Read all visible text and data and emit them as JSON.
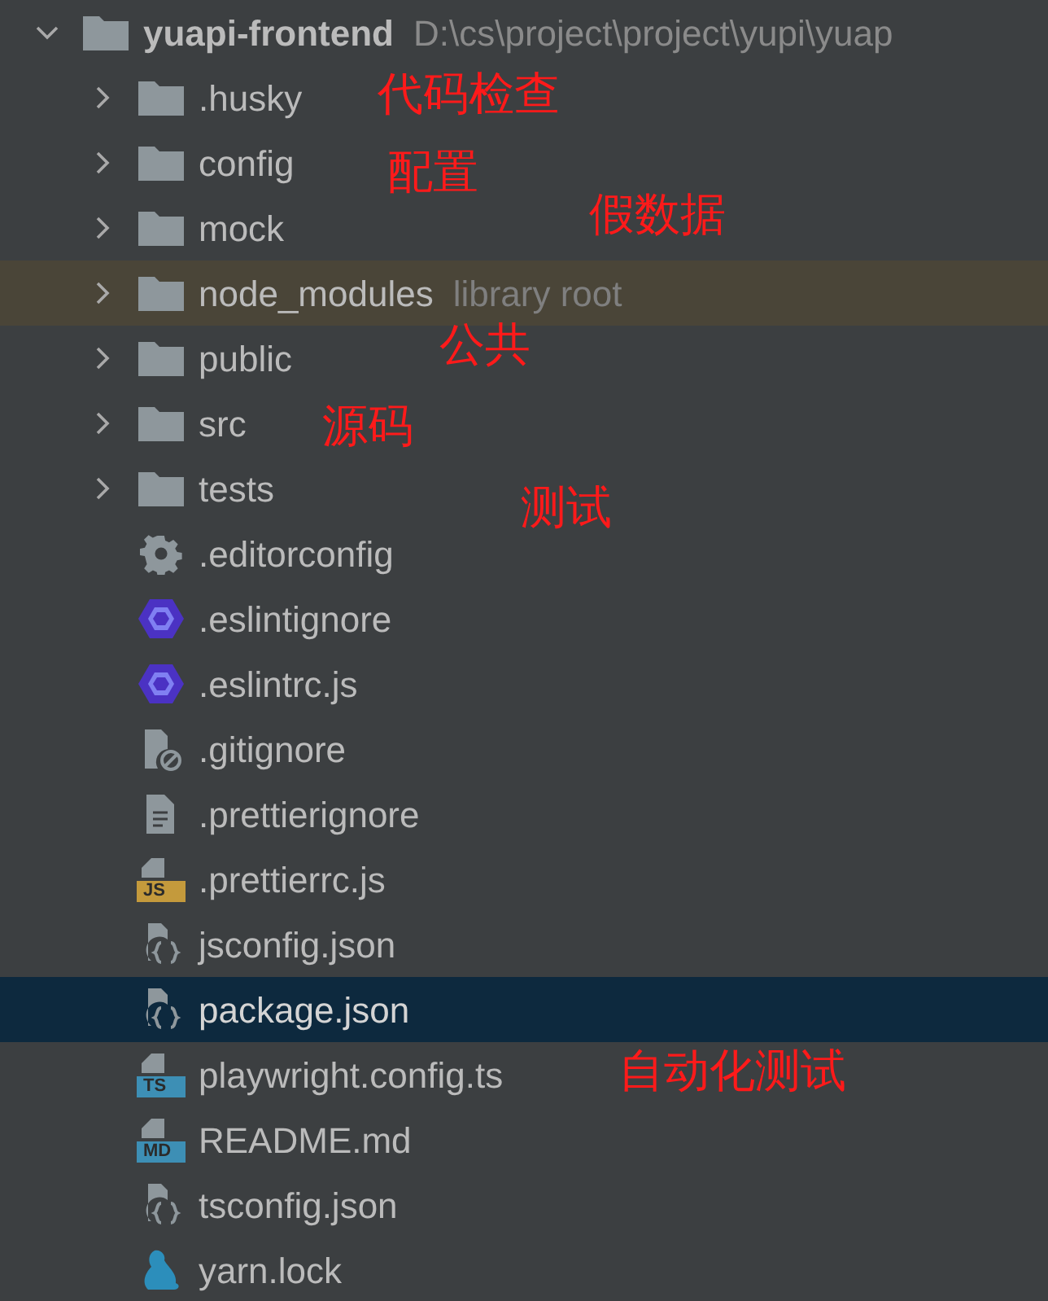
{
  "tree": {
    "name": "yuapi-frontend",
    "path": "D:\\cs\\project\\project\\yupi\\yuap",
    "kind": "folder",
    "expanded": true,
    "selected": false,
    "highlighted": false,
    "children": [
      {
        "name": ".husky",
        "kind": "folder",
        "expanded": false,
        "selected": false,
        "highlighted": false
      },
      {
        "name": "config",
        "kind": "folder",
        "expanded": false,
        "selected": false,
        "highlighted": false
      },
      {
        "name": "mock",
        "kind": "folder",
        "expanded": false,
        "selected": false,
        "highlighted": false
      },
      {
        "name": "node_modules",
        "kind": "folder",
        "expanded": false,
        "selected": false,
        "highlighted": true,
        "hint": "library root"
      },
      {
        "name": "public",
        "kind": "folder",
        "expanded": false,
        "selected": false,
        "highlighted": false
      },
      {
        "name": "src",
        "kind": "folder",
        "expanded": false,
        "selected": false,
        "highlighted": false
      },
      {
        "name": "tests",
        "kind": "folder",
        "expanded": false,
        "selected": false,
        "highlighted": false
      },
      {
        "name": ".editorconfig",
        "kind": "settings",
        "selected": false,
        "highlighted": false
      },
      {
        "name": ".eslintignore",
        "kind": "eslint",
        "selected": false,
        "highlighted": false
      },
      {
        "name": ".eslintrc.js",
        "kind": "eslint",
        "selected": false,
        "highlighted": false
      },
      {
        "name": ".gitignore",
        "kind": "ignored",
        "selected": false,
        "highlighted": false
      },
      {
        "name": ".prettierignore",
        "kind": "text",
        "selected": false,
        "highlighted": false
      },
      {
        "name": ".prettierrc.js",
        "kind": "typed",
        "badge": "JS",
        "color": "#c49a3c",
        "selected": false,
        "highlighted": false
      },
      {
        "name": "jsconfig.json",
        "kind": "json",
        "selected": false,
        "highlighted": false
      },
      {
        "name": "package.json",
        "kind": "json",
        "selected": true,
        "highlighted": false
      },
      {
        "name": "playwright.config.ts",
        "kind": "typed",
        "badge": "TS",
        "color": "#3d8fb5",
        "selected": false,
        "highlighted": false
      },
      {
        "name": "README.md",
        "kind": "typed",
        "badge": "MD",
        "color": "#3d8fb5",
        "selected": false,
        "highlighted": false
      },
      {
        "name": "tsconfig.json",
        "kind": "json",
        "selected": false,
        "highlighted": false
      },
      {
        "name": "yarn.lock",
        "kind": "yarn",
        "selected": false,
        "highlighted": false
      }
    ]
  },
  "annotations": [
    "代码检查",
    "配置",
    "假数据",
    "公共",
    "源码",
    "测试",
    "自动化测试"
  ]
}
